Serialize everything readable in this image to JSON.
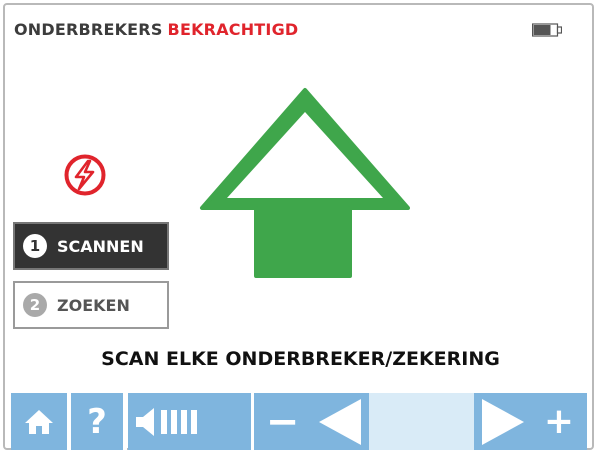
{
  "header": {
    "title_part1": "ONDERBREKERS",
    "title_part2": "BEKRACHTIGD",
    "title_part2_color": "#e0242c",
    "battery_icon": "battery-icon"
  },
  "status": {
    "hazard_icon": "lightning-hazard-icon",
    "direction_icon": "up-arrow-icon",
    "direction_color": "#3fa64b"
  },
  "steps": [
    {
      "number": "1",
      "label": "SCANNEN",
      "active": true
    },
    {
      "number": "2",
      "label": "ZOEKEN",
      "active": false
    }
  ],
  "instruction": "SCAN ELKE ONDERBREKER/ZEKERING",
  "toolbar": {
    "accent": "#7fb5de",
    "help_label": "?",
    "minus_label": "−",
    "plus_label": "+",
    "icons": [
      "home-icon",
      "help-icon",
      "volume-icon",
      "minus-icon",
      "prev-arrow-icon",
      "next-arrow-icon",
      "plus-icon"
    ]
  }
}
